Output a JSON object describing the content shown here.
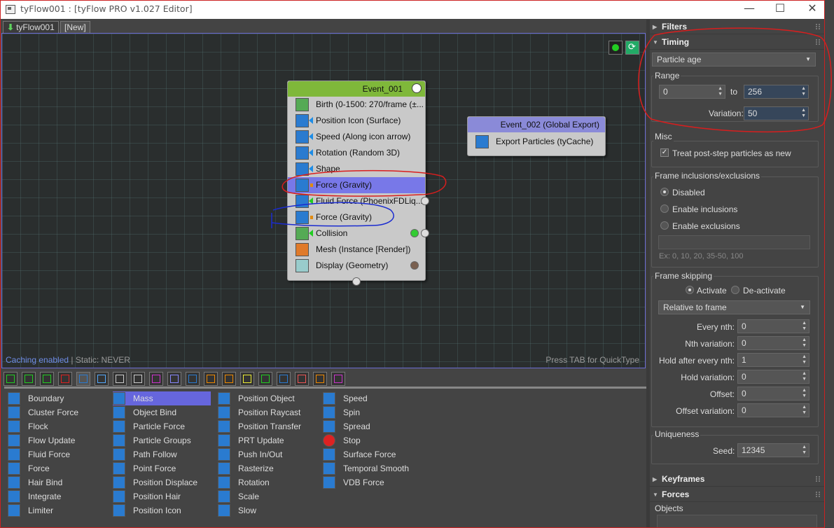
{
  "window": {
    "title": "tyFlow001 : [tyFlow PRO v1.027 Editor]",
    "min": "—",
    "max": "☐",
    "close": "✕"
  },
  "tabs": [
    {
      "label": "tyFlow001",
      "active": true
    },
    {
      "label": "[New]",
      "active": false
    }
  ],
  "canvas": {
    "status_caching": "Caching enabled",
    "status_static": "| Static: NEVER",
    "hint": "Press TAB for QuickType"
  },
  "event1": {
    "title": "Event_001",
    "header_color": "#7fb83a",
    "operators": [
      {
        "label": "Birth (0-1500: 270/frame (±...",
        "icon": "birth-icon"
      },
      {
        "label": "Position Icon (Surface)",
        "icon": "position-icon-icon"
      },
      {
        "label": "Speed (Along icon arrow)",
        "icon": "speed-icon"
      },
      {
        "label": "Rotation (Random 3D)",
        "icon": "rotation-icon"
      },
      {
        "label": "Shape",
        "icon": "shape-icon"
      },
      {
        "label": "Force (Gravity)",
        "icon": "force-icon",
        "selected": true
      },
      {
        "label": "Fluid Force (PhoenixFDLiq...",
        "icon": "fluid-force-icon"
      },
      {
        "label": "Force (Gravity)",
        "icon": "force-icon"
      },
      {
        "label": "Collision",
        "icon": "collision-icon"
      },
      {
        "label": "Mesh (Instance [Render])",
        "icon": "mesh-icon"
      },
      {
        "label": "Display (Geometry)",
        "icon": "display-icon"
      }
    ]
  },
  "event2": {
    "title": "Event_002 (Global Export)",
    "header_color": "#8a8ad8",
    "operators": [
      {
        "label": "Export Particles (tyCache)",
        "icon": "export-particles-icon"
      }
    ]
  },
  "operator_list": {
    "col1": [
      "Boundary",
      "Cluster Force",
      "Flock",
      "Flow Update",
      "Fluid Force",
      "Force",
      "Hair Bind",
      "Integrate",
      "Limiter"
    ],
    "col2": [
      "Mass",
      "Object Bind",
      "Particle Force",
      "Particle Groups",
      "Path Follow",
      "Point Force",
      "Position Displace",
      "Position Hair",
      "Position Icon"
    ],
    "col3": [
      "Position Object",
      "Position Raycast",
      "Position Transfer",
      "PRT Update",
      "Push In/Out",
      "Rasterize",
      "Rotation",
      "Scale",
      "Slow"
    ],
    "col4": [
      "Speed",
      "Spin",
      "Spread",
      "Stop",
      "Surface Force",
      "Temporal Smooth",
      "VDB Force"
    ],
    "selected": "Mass"
  },
  "panel": {
    "filters": "Filters",
    "timing": "Timing",
    "timing_mode": "Particle age",
    "range_label": "Range",
    "range_from": "0",
    "range_to_label": "to",
    "range_to": "256",
    "variation_label": "Variation:",
    "variation": "50",
    "misc_label": "Misc",
    "treat_post_step": "Treat post-step particles as new",
    "frame_incl_label": "Frame inclusions/exclusions",
    "disabled": "Disabled",
    "enable_inclusions": "Enable inclusions",
    "enable_exclusions": "Enable exclusions",
    "frames_placeholder": "Ex: 0, 10, 20, 35-50, 100",
    "frame_skipping_label": "Frame skipping",
    "activate": "Activate",
    "deactivate": "De-activate",
    "relative_mode": "Relative to frame",
    "fields": [
      {
        "label": "Every nth:",
        "value": "0"
      },
      {
        "label": "Nth variation:",
        "value": "0"
      },
      {
        "label": "Hold after every nth:",
        "value": "1"
      },
      {
        "label": "Hold variation:",
        "value": "0"
      },
      {
        "label": "Offset:",
        "value": "0"
      },
      {
        "label": "Offset variation:",
        "value": "0"
      }
    ],
    "uniqueness_label": "Uniqueness",
    "seed_label": "Seed:",
    "seed": "12345",
    "keyframes": "Keyframes",
    "forces": "Forces",
    "objects_label": "Objects"
  },
  "colors": {
    "annotation_red": "#d81e1e",
    "annotation_blue": "#1a2bd0",
    "selection": "#7878e8"
  }
}
